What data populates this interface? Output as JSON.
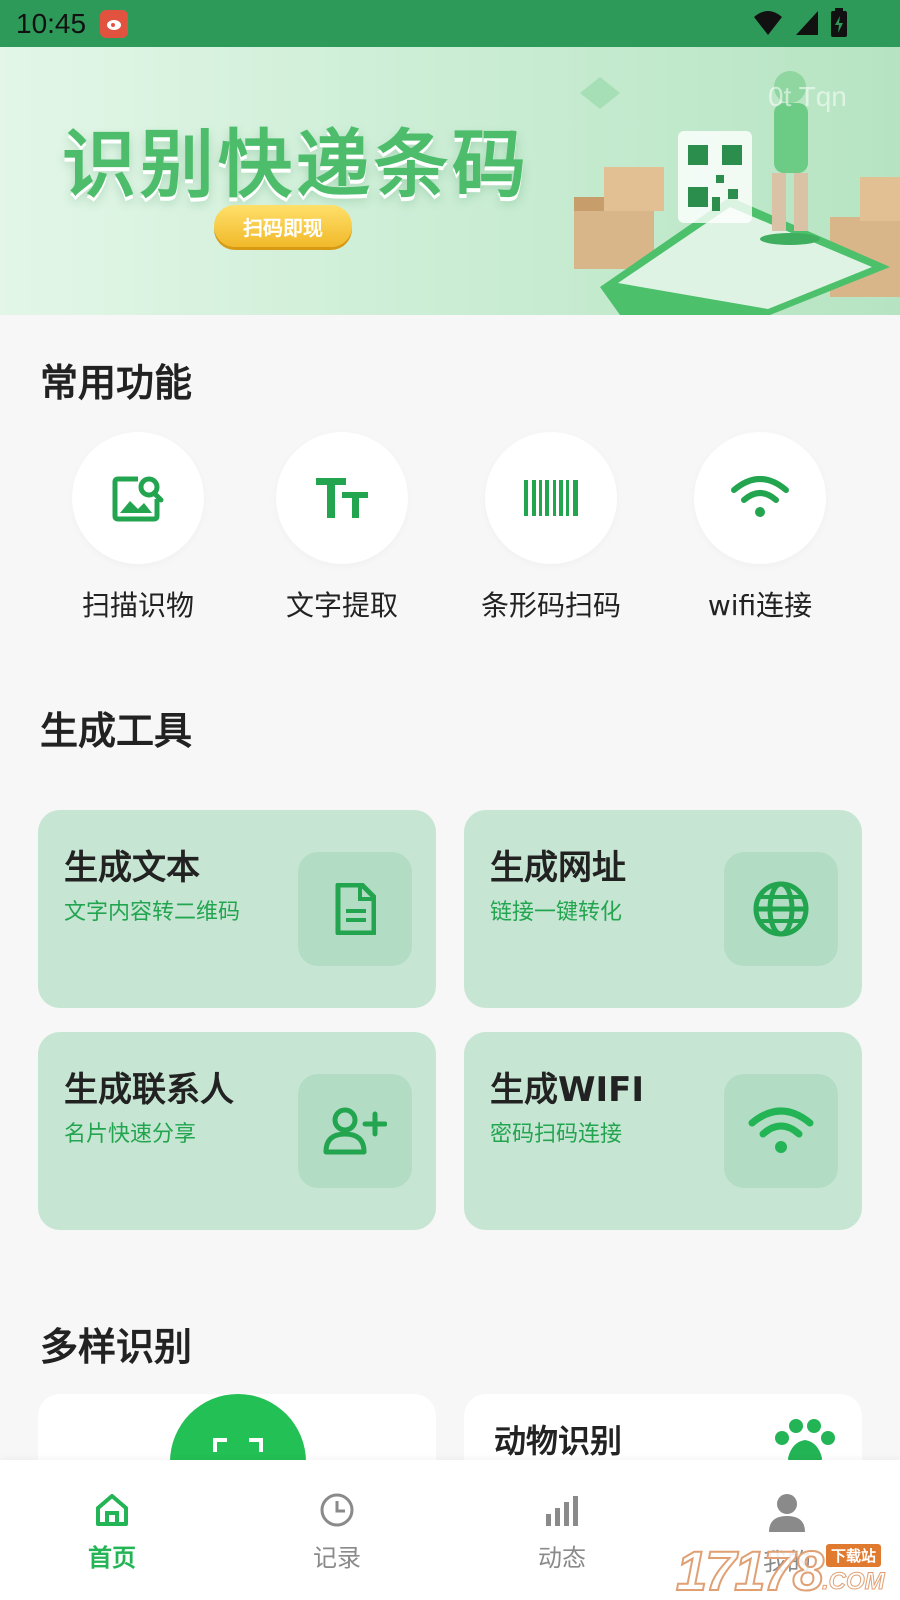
{
  "status_bar": {
    "time": "10:45"
  },
  "banner": {
    "title": "识别快递条码",
    "button": "扫码即现",
    "watermark": "0t Tqn"
  },
  "sections": {
    "common": "常用功能",
    "tools": "生成工具",
    "recognition": "多样识别"
  },
  "quick_actions": [
    {
      "label": "扫描识物",
      "icon": "image-search-icon"
    },
    {
      "label": "文字提取",
      "icon": "text-size-icon"
    },
    {
      "label": "条形码扫码",
      "icon": "barcode-icon"
    },
    {
      "label": "wifi连接",
      "icon": "wifi-icon"
    }
  ],
  "tools": [
    {
      "title": "生成文本",
      "subtitle": "文字内容转二维码",
      "icon": "document-icon"
    },
    {
      "title": "生成网址",
      "subtitle": "链接一键转化",
      "icon": "globe-icon"
    },
    {
      "title": "生成联系人",
      "subtitle": "名片快速分享",
      "icon": "add-user-icon"
    },
    {
      "title": "生成WIFI",
      "subtitle": "密码扫码连接",
      "icon": "wifi-icon"
    }
  ],
  "recognition": [
    {
      "title": "",
      "icon": "scan-icon"
    },
    {
      "title": "动物识别",
      "icon": "paw-icon"
    }
  ],
  "nav": [
    {
      "label": "首页",
      "icon": "home-icon",
      "active": true
    },
    {
      "label": "记录",
      "icon": "clock-icon",
      "active": false
    },
    {
      "label": "动态",
      "icon": "bar-chart-icon",
      "active": false
    },
    {
      "label": "我的",
      "icon": "user-icon",
      "active": false
    }
  ],
  "site_watermark": {
    "number": "17178",
    "tag": "下载站",
    "domain": ".COM"
  },
  "colors": {
    "accent": "#23b455",
    "status_bar": "#2e9a5a",
    "card_bg": "#c6e6d3",
    "icon_box": "#b3dcc4",
    "banner_title": "#4dbd6c"
  }
}
